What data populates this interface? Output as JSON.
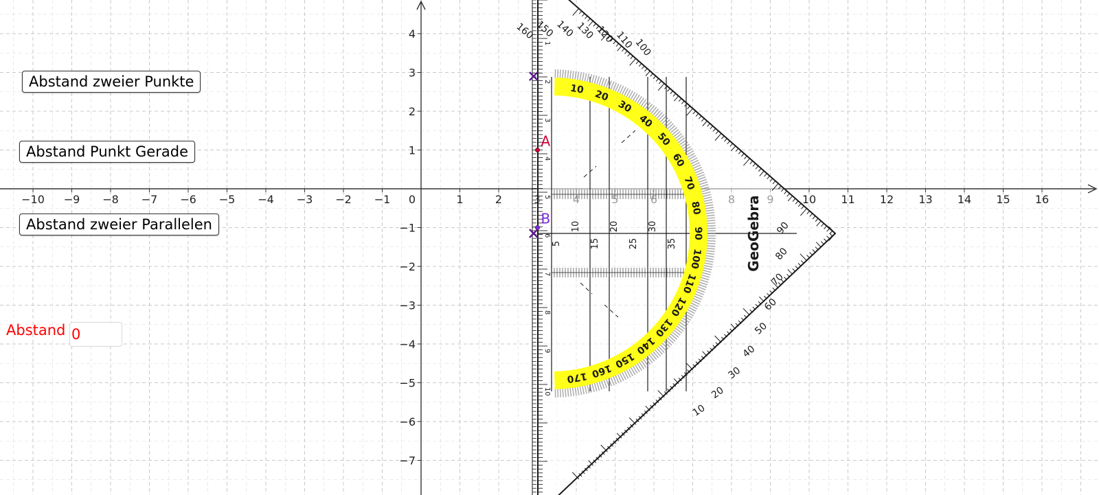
{
  "buttons": {
    "punkte": "Abstand zweier Punkte",
    "gerade": "Abstand Punkt Gerade",
    "parallelen": "Abstand zweier Parallelen"
  },
  "abstand": {
    "label": "Abstand",
    "value": "0"
  },
  "axes": {
    "x_ticks": [
      -10,
      -9,
      -8,
      -7,
      -6,
      -5,
      -4,
      -3,
      -2,
      -1,
      1,
      2,
      3,
      4,
      5,
      6,
      7,
      8,
      9,
      10,
      11,
      12,
      13,
      14,
      15,
      16
    ],
    "y_ticks": [
      4,
      3,
      2,
      1,
      -1,
      -2,
      -3,
      -4,
      -5,
      -6,
      -7
    ],
    "origin_label": "0"
  },
  "points": [
    {
      "name": "A",
      "x": 3.0,
      "y": 1.0,
      "color": "#cc0033"
    },
    {
      "name": "B",
      "x": 3.0,
      "y": -1.0,
      "color": "#7a28d9"
    }
  ],
  "markers": [
    {
      "x": 2.9,
      "y": 2.9,
      "color": "#5a1a8a"
    },
    {
      "x": 2.9,
      "y": -1.15,
      "color": "#5a1a8a"
    }
  ],
  "triangle": {
    "brand": "GeoGebra",
    "arc_labels": [
      "10",
      "20",
      "30",
      "40",
      "50",
      "60",
      "70",
      "80",
      "90",
      "100",
      "110",
      "120",
      "130",
      "140",
      "150",
      "160",
      "170"
    ],
    "outer_labels_top": [
      "160",
      "150",
      "140",
      "130",
      "120",
      "110",
      "100"
    ],
    "outer_labels_bottom": [
      "90",
      "80",
      "70",
      "60",
      "50",
      "40",
      "30",
      "20",
      "10"
    ],
    "inner_scale": [
      "5",
      "10",
      "15",
      "20",
      "25",
      "30",
      "35"
    ],
    "edge_labels": [
      "1",
      "2",
      "3",
      "4",
      "5",
      "6",
      "7",
      "8",
      "9",
      "10"
    ],
    "colors": {
      "arc": "#ffff1a",
      "ink": "#1a1a1a"
    }
  },
  "colors": {
    "grid": "#c8c8c8",
    "axis": "#333333"
  }
}
